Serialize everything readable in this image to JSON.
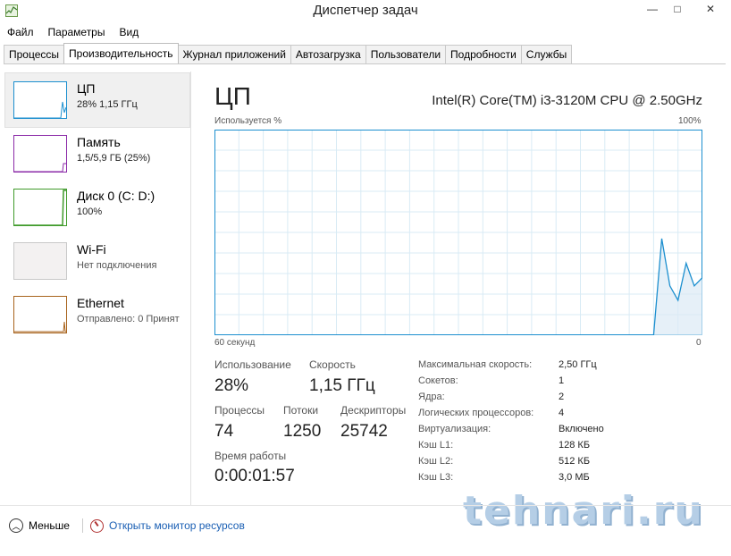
{
  "window": {
    "title": "Диспетчер задач",
    "min": "—",
    "max": "□",
    "close": "✕"
  },
  "menu": [
    "Файл",
    "Параметры",
    "Вид"
  ],
  "tabs": [
    "Процессы",
    "Производительность",
    "Журнал приложений",
    "Автозагрузка",
    "Пользователи",
    "Подробности",
    "Службы"
  ],
  "active_tab": "Производительность",
  "sidebar": [
    {
      "name": "ЦП",
      "sub": "28% 1,15 ГГц",
      "color": "#1c8fcf"
    },
    {
      "name": "Память",
      "sub": "1,5/5,9 ГБ (25%)",
      "color": "#8b2aa8"
    },
    {
      "name": "Диск 0 (C: D:)",
      "sub": "100%",
      "color": "#3f9a2a"
    },
    {
      "name": "Wi-Fi",
      "sub": "Нет подключения",
      "color": "#c8c8c8"
    },
    {
      "name": "Ethernet",
      "sub": "Отправлено: 0 Принят",
      "color": "#a8631c"
    }
  ],
  "main": {
    "title": "ЦП",
    "cpu_model": "Intel(R) Core(TM) i3-3120M CPU @ 2.50GHz",
    "graph_label": "Используется %",
    "graph_max": "100%",
    "axis_left": "60 секунд",
    "axis_right": "0",
    "stats": {
      "usage_label": "Использование",
      "usage": "28%",
      "speed_label": "Скорость",
      "speed": "1,15 ГГц",
      "processes_label": "Процессы",
      "processes": "74",
      "threads_label": "Потоки",
      "threads": "1250",
      "handles_label": "Дескрипторы",
      "handles": "25742",
      "uptime_label": "Время работы",
      "uptime": "0:00:01:57"
    },
    "details": [
      {
        "k": "Максимальная скорость:",
        "v": "2,50 ГГц"
      },
      {
        "k": "Сокетов:",
        "v": "1"
      },
      {
        "k": "Ядра:",
        "v": "2"
      },
      {
        "k": "Логических процессоров:",
        "v": "4"
      },
      {
        "k": "Виртуализация:",
        "v": "Включено"
      },
      {
        "k": "Кэш L1:",
        "v": "128 КБ"
      },
      {
        "k": "Кэш L2:",
        "v": "512 КБ"
      },
      {
        "k": "Кэш L3:",
        "v": "3,0 МБ"
      }
    ],
    "cpu_history_percent": [
      0,
      0,
      0,
      0,
      0,
      0,
      0,
      0,
      0,
      0,
      0,
      0,
      0,
      0,
      0,
      0,
      0,
      0,
      0,
      0,
      0,
      0,
      0,
      0,
      0,
      0,
      0,
      0,
      0,
      0,
      0,
      0,
      0,
      0,
      0,
      0,
      0,
      0,
      0,
      0,
      0,
      0,
      0,
      0,
      0,
      0,
      0,
      0,
      0,
      0,
      0,
      0,
      0,
      0,
      0,
      47,
      24,
      17,
      35,
      24,
      28
    ]
  },
  "footer": {
    "fewer": "Меньше",
    "monitor": "Открыть монитор ресурсов"
  },
  "watermark": "tehnari.ru"
}
